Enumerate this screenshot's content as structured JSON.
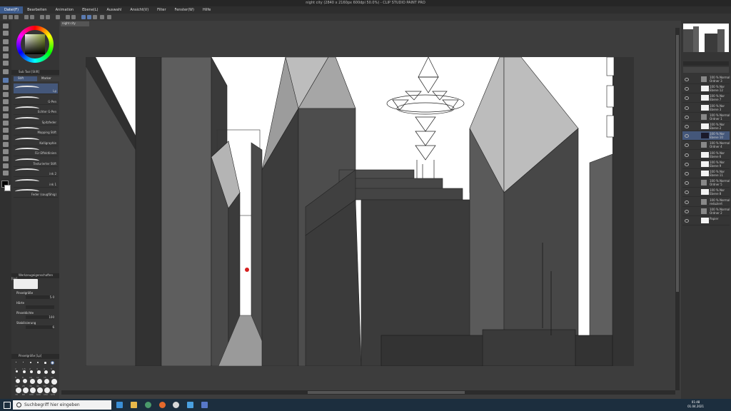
{
  "window": {
    "title": "night city (2840 x 2160px 600dpi 50.0%) - CLIP STUDIO PAINT PRO"
  },
  "menu": [
    "Datei(F)",
    "Bearbeiten",
    "Animation",
    "Ebene(L)",
    "Auswahl",
    "Ansicht(V)",
    "Filter",
    "Fenster(W)",
    "Hilfe"
  ],
  "document_tab": "night city",
  "subtool_panel": {
    "header": "Sub Tool [Stift]",
    "tabs": [
      "Stift",
      "Marker"
    ],
    "brushes": [
      "Lp",
      "G-Pen",
      "Echter G-Pen",
      "Spitzfeder",
      "Mapping Stift",
      "Kalligraphie",
      "Für Effektlinien",
      "Texturierter Stift",
      "ink 2",
      "ink 1",
      "Feder (saugfähig)"
    ]
  },
  "tool_property": {
    "header": "Werkzeugeigenschaften [Lp]",
    "props": [
      {
        "label": "Pinselgröße",
        "value": "5.0"
      },
      {
        "label": "Härte",
        "value": ""
      },
      {
        "label": "Pinseldichte",
        "value": "100"
      },
      {
        "label": "Stabilisierung",
        "value": "6"
      }
    ]
  },
  "brush_size_panel": {
    "header": "Pinselgröße [Lp]",
    "sizes": [
      "1",
      "1.5",
      "2",
      "3",
      "4",
      "5",
      "6",
      "8",
      "10",
      "12",
      "15",
      "17",
      "20",
      "25",
      "30",
      "40",
      "50",
      "60",
      "70",
      "80",
      "100",
      "120",
      "150",
      "170"
    ]
  },
  "layers": [
    {
      "name": "100 % Normal\nOrdner 3",
      "folder": true
    },
    {
      "name": "100 % Nor\nEbene 12"
    },
    {
      "name": "100 % Nor\nEbene 7"
    },
    {
      "name": "100 % Nor\nEbene 3"
    },
    {
      "name": "100 % Normal\nOrdner 1",
      "folder": true
    },
    {
      "name": "100 % Nor\nEbene 2"
    },
    {
      "name": "100 % Nor\nEbene 10",
      "selected": true
    },
    {
      "name": "100 % Normal\nOrdner 4",
      "folder": true
    },
    {
      "name": "100 % Nor\nEbene 6"
    },
    {
      "name": "100 % Nor\nEbene 9"
    },
    {
      "name": "100 % Nor\nEbene 11"
    },
    {
      "name": "100 % Normal\nOrdner 5",
      "folder": true
    },
    {
      "name": "100 % Nor\nEbene 8"
    },
    {
      "name": "100 % Normal\nreduziert",
      "folder": true
    },
    {
      "name": "100 % Normal\nOrdner 2",
      "folder": true
    },
    {
      "name": "Papier"
    }
  ],
  "taskbar": {
    "search_placeholder": "Suchbegriff hier eingeben",
    "time": "01:48",
    "date": "01.04.2021"
  },
  "colors": {
    "accent": "#3d5b8c",
    "brush_dot": "#d62020"
  }
}
